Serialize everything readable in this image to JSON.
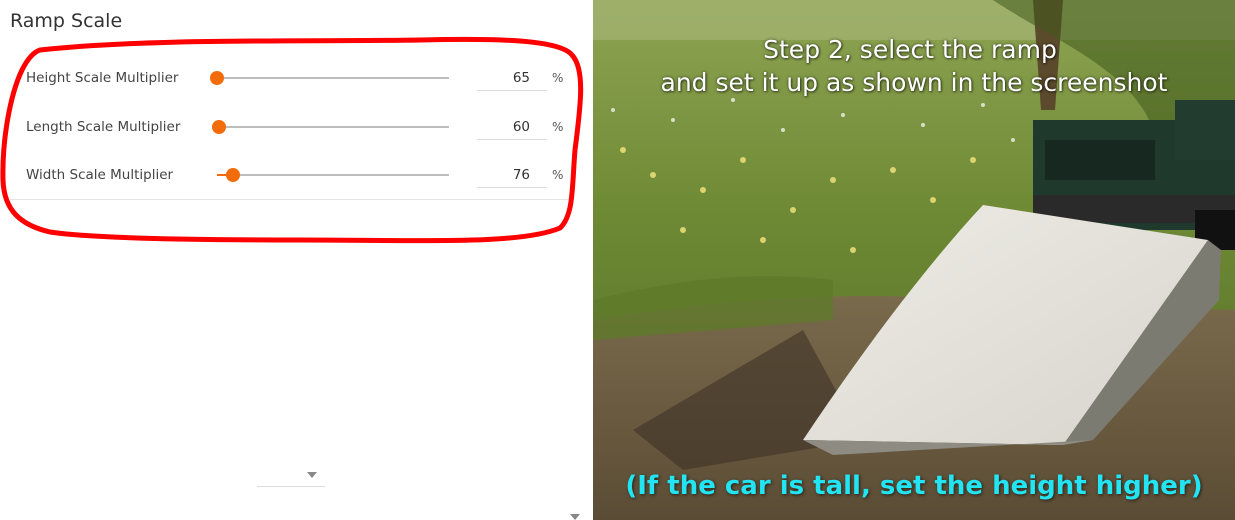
{
  "panel": {
    "title": "Ramp Scale",
    "rows": [
      {
        "label": "Height Scale Multiplier",
        "value": "65",
        "unit": "%",
        "slider_fraction": 0.0
      },
      {
        "label": "Length Scale Multiplier",
        "value": "60",
        "unit": "%",
        "slider_fraction": 0.01
      },
      {
        "label": "Width Scale Multiplier",
        "value": "76",
        "unit": "%",
        "slider_fraction": 0.07
      }
    ],
    "accent_color": "#f36c0b",
    "highlight_color": "#ff0000"
  },
  "dropdown": {
    "icon": "chevron-down-icon"
  },
  "scene": {
    "caption_line1": "Step 2, select the ramp",
    "caption_line2": "and set it up as shown in the screenshot",
    "note": "(If the car is tall, set the height higher)",
    "note_color": "#22e4f2"
  }
}
